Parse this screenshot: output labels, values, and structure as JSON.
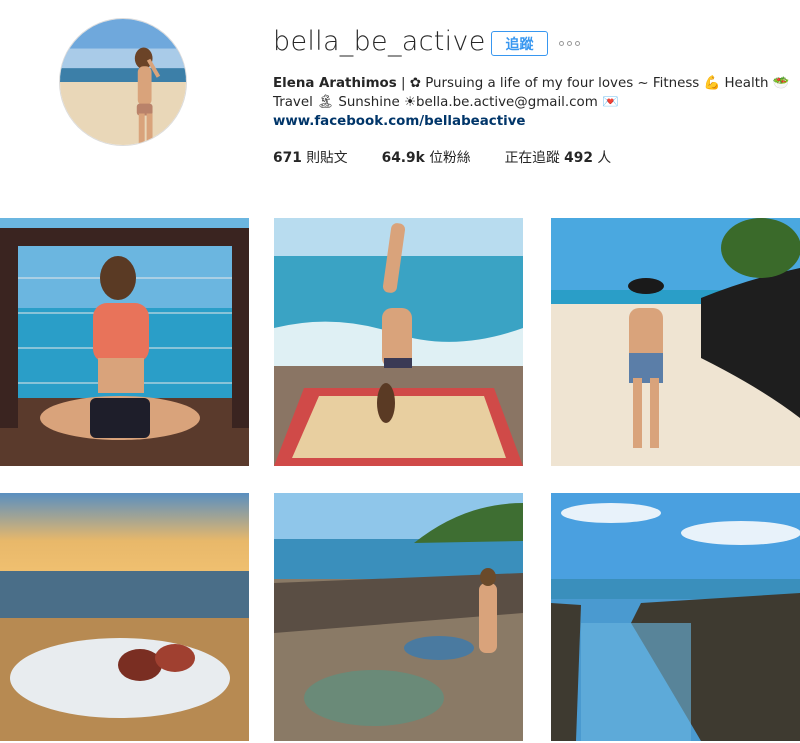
{
  "profile": {
    "username": "bella_be_active",
    "follow_label": "追蹤",
    "more_icon": "ellipsis-icon",
    "full_name": "Elena Arathimos",
    "bio_line1": "| ✿ Pursuing a life of my four loves ~ Fitness 💪 Health 🥗",
    "bio_line2": "Travel 🏝 Sunshine ☀bella.be.active@gmail.com 💌",
    "website": "www.facebook.com/bellabeactive"
  },
  "stats": {
    "posts_count": "671",
    "posts_label": "則貼文",
    "followers_count": "64.9k",
    "followers_label": "位粉絲",
    "following_label": "正在追蹤",
    "following_count": "492",
    "following_unit": "人"
  },
  "posts": [
    {
      "subject": "woman sitting cross-legged on deck by ocean"
    },
    {
      "subject": "woman doing handstand on rug by sea"
    },
    {
      "subject": "woman in hat walking on beach"
    },
    {
      "subject": "blanket on beach at sunset"
    },
    {
      "subject": "woman standing on rocks by tide pool"
    },
    {
      "subject": "rock pool under blue sky"
    }
  ],
  "colors": {
    "accent": "#3897f0",
    "link": "#003569",
    "text": "#262626"
  }
}
